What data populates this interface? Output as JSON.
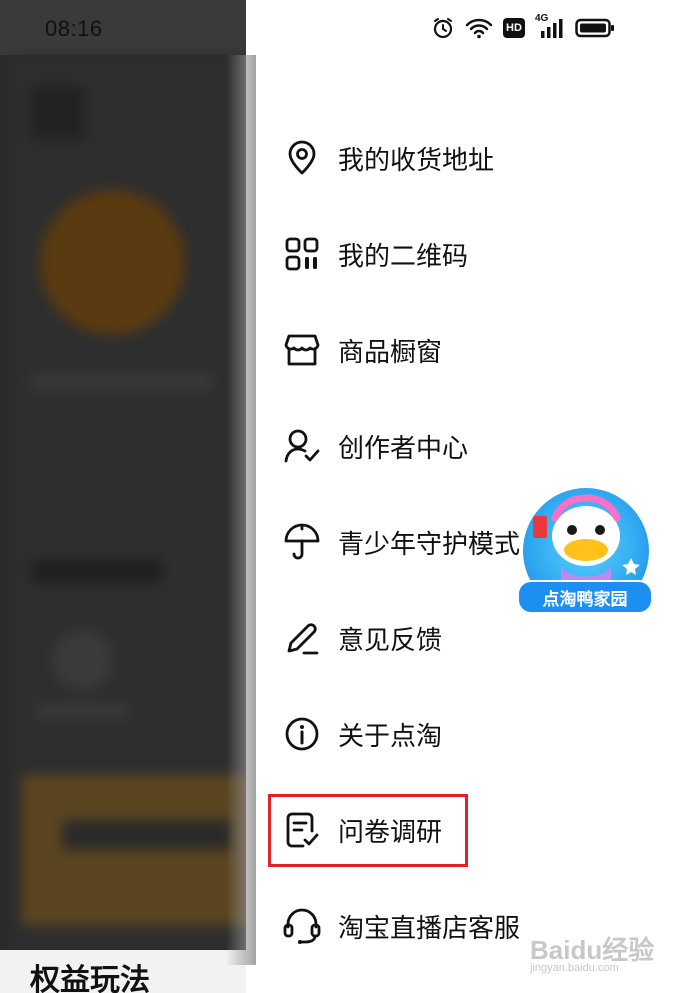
{
  "status_bar": {
    "time": "08:16",
    "hd_label": "HD",
    "network_label": "4G"
  },
  "background": {
    "bottom_title": "权益玩法"
  },
  "menu": {
    "items": [
      {
        "label": "我的收货地址",
        "icon": "location-pin-icon"
      },
      {
        "label": "我的二维码",
        "icon": "qr-code-icon"
      },
      {
        "label": "商品橱窗",
        "icon": "shop-window-icon"
      },
      {
        "label": "创作者中心",
        "icon": "creator-icon"
      },
      {
        "label": "青少年守护模式",
        "icon": "umbrella-icon"
      },
      {
        "label": "意见反馈",
        "icon": "edit-pencil-icon"
      },
      {
        "label": "关于点淘",
        "icon": "info-icon"
      },
      {
        "label": "问卷调研",
        "icon": "survey-icon"
      },
      {
        "label": "淘宝直播店客服",
        "icon": "headset-icon"
      }
    ],
    "highlighted_item": "问卷调研",
    "highlight_color": "#e0202a"
  },
  "promo": {
    "label": "点淘鸭家园"
  },
  "watermark": {
    "main": "Baidu经验",
    "sub": "jingyan.baidu.com"
  }
}
